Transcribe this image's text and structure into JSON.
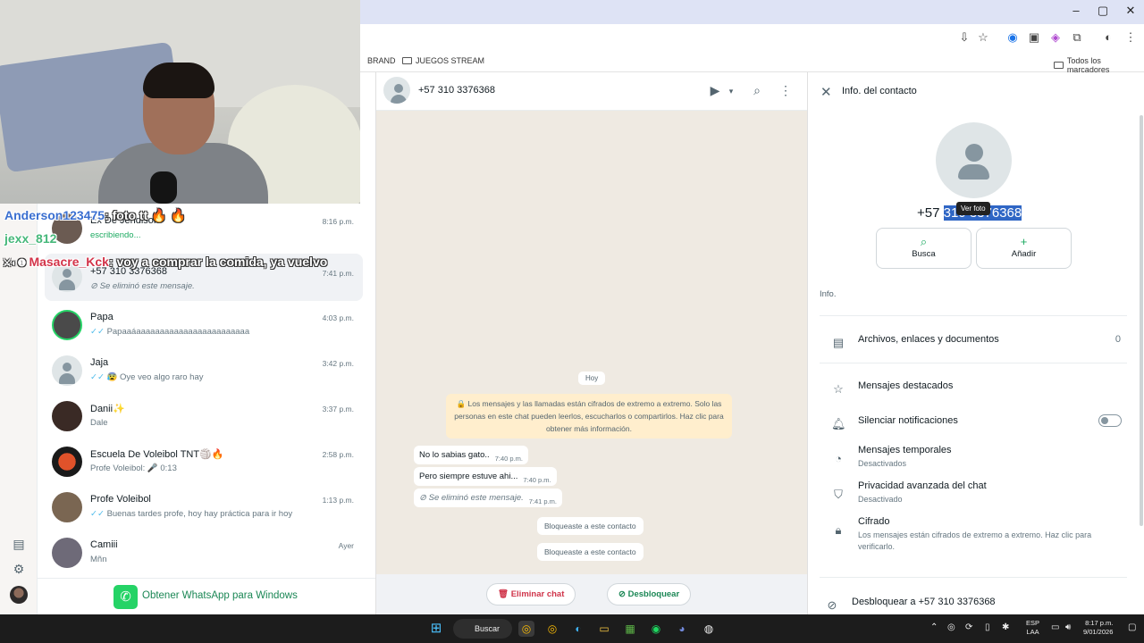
{
  "browser": {
    "bookmarks": [
      "BRAND",
      "JUEGOS STREAM"
    ],
    "bookmarks_all": "Todos los marcadores"
  },
  "stream_chat": [
    {
      "user": "Anderson123475",
      "message": ": foto tt 🔥 🔥"
    },
    {
      "user": "jexx_812",
      "message": ""
    },
    {
      "user": "Masacre_Kck",
      "message": ": voy a comprar la comida, ya vuelvo"
    }
  ],
  "chat_list": [
    {
      "name": "Ex De Jendison",
      "preview": "escribiendo...",
      "time": "8:16 p.m."
    },
    {
      "name": "+57 310 3376368",
      "preview": "Se eliminó este mensaje.",
      "time": "7:41 p.m."
    },
    {
      "name": "Papa",
      "preview": "Papaaáaaaaaaaaaaaaaaaaaaaaaaaa",
      "time": "4:03 p.m."
    },
    {
      "name": "Jaja",
      "preview": "😰 Oye veo algo raro hay",
      "time": "3:42 p.m."
    },
    {
      "name": "Danii✨",
      "preview": "Dale",
      "time": "3:37 p.m."
    },
    {
      "name": "Escuela De Voleibol TNT🏐🔥",
      "preview": "Profe Voleibol: 🎤 0:13",
      "time": "2:58 p.m."
    },
    {
      "name": "Profe Voleibol",
      "preview": "Buenas tardes profe, hoy hay práctica para ir hoy",
      "time": "1:13 p.m."
    },
    {
      "name": "Camiii",
      "preview": "Mñn",
      "time": "Ayer"
    }
  ],
  "get_whatsapp": "Obtener WhatsApp para Windows",
  "conversation": {
    "title": "+57 310 3376368",
    "date_pill": "Hoy",
    "encryption_notice": "🔒 Los mensajes y las llamadas están cifrados de extremo a extremo. Solo las personas en este chat pueden leerlos, escucharlos o compartirlos. Haz clic para obtener más información.",
    "messages": [
      {
        "text": "No lo sabias gato..",
        "time": "7:40 p.m."
      },
      {
        "text": "Pero siempre estuve ahi...",
        "time": "7:40 p.m."
      },
      {
        "text": "Se eliminó este mensaje.",
        "time": "7:41 p.m."
      }
    ],
    "system_messages": [
      "Bloqueaste a este contacto",
      "Bloqueaste a este contacto"
    ],
    "delete_chat": "Eliminar chat",
    "unblock": "Desbloquear"
  },
  "contact_info": {
    "title": "Info. del contacto",
    "tooltip": "Ver foto",
    "number_prefix": "+57 ",
    "number_selected": "310 3376368",
    "actions": [
      "Busca",
      "Añadir"
    ],
    "info_label": "Info.",
    "files_label": "Archivos, enlaces y documentos",
    "files_count": "0",
    "starred": "Mensajes destacados",
    "mute": "Silenciar notificaciones",
    "mute_on": false,
    "disappearing": "Mensajes temporales",
    "disappearing_sub": "Desactivados",
    "privacy": "Privacidad avanzada del chat",
    "privacy_sub": "Desactivado",
    "encryption": "Cifrado",
    "encryption_sub": "Los mensajes están cifrados de extremo a extremo. Haz clic para verificarlo.",
    "unblock_contact": "Desbloquear a +57 310 3376368"
  },
  "taskbar": {
    "search": "Buscar",
    "lang_line1": "ESP",
    "lang_line2": "LAA",
    "time": "8:17 p.m.",
    "date": "9/01/2026"
  }
}
